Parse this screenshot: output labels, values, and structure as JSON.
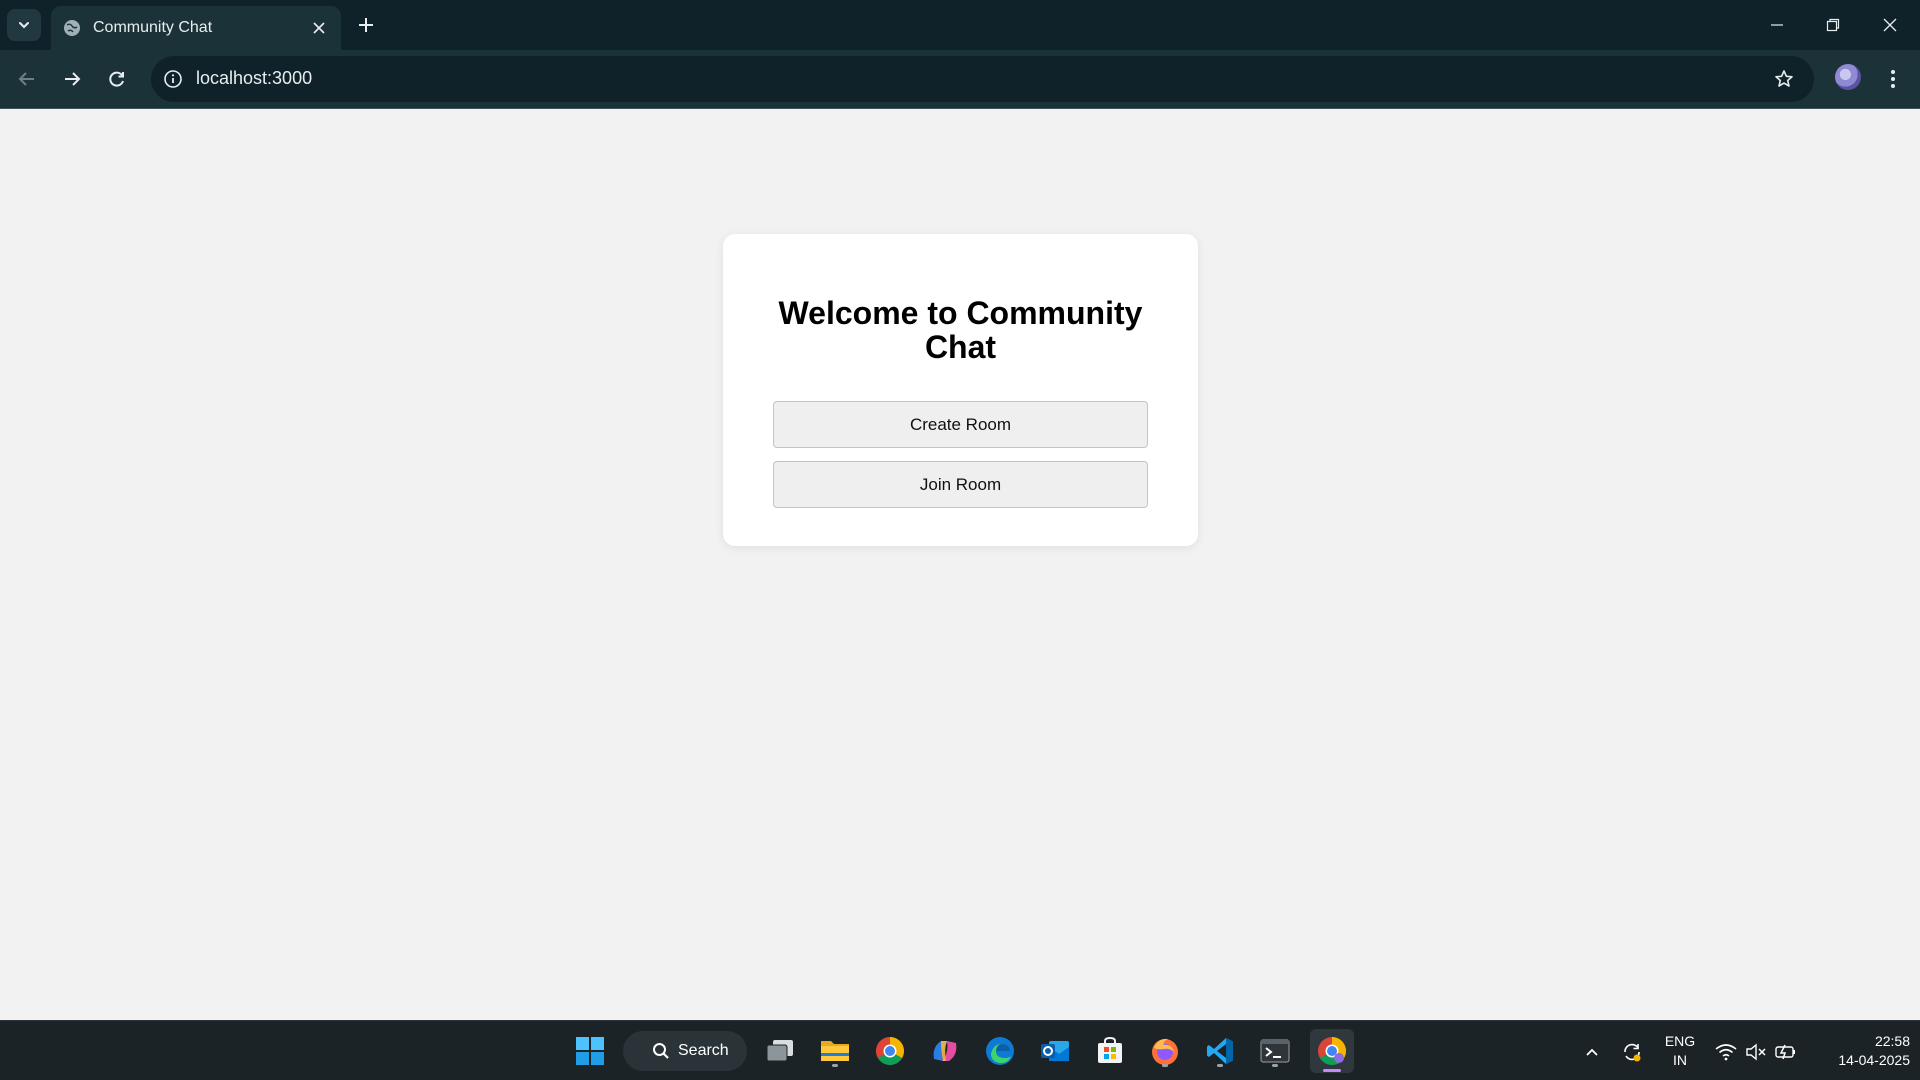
{
  "browser": {
    "tab_title": "Community Chat",
    "url": "localhost:3000"
  },
  "page": {
    "heading": "Welcome to Community Chat",
    "create_room_label": "Create Room",
    "join_room_label": "Join Room"
  },
  "taskbar": {
    "search_label": "Search",
    "apps": [
      "windows-start",
      "task-view",
      "file-explorer",
      "chrome",
      "copilot",
      "edge",
      "outlook",
      "microsoft-store",
      "firefox",
      "vscode",
      "terminal",
      "chrome-active"
    ],
    "language_line1": "ENG",
    "language_line2": "IN",
    "time": "22:58",
    "date": "14-04-2025"
  },
  "colors": {
    "chrome_dark": "#0f2229",
    "chrome_toolbar": "#1c3239",
    "page_bg": "#f2f2f2",
    "card_bg": "#ffffff",
    "button_bg": "#efefef",
    "taskbar_bg": "#1b2327",
    "active_indicator": "#c58af9"
  }
}
